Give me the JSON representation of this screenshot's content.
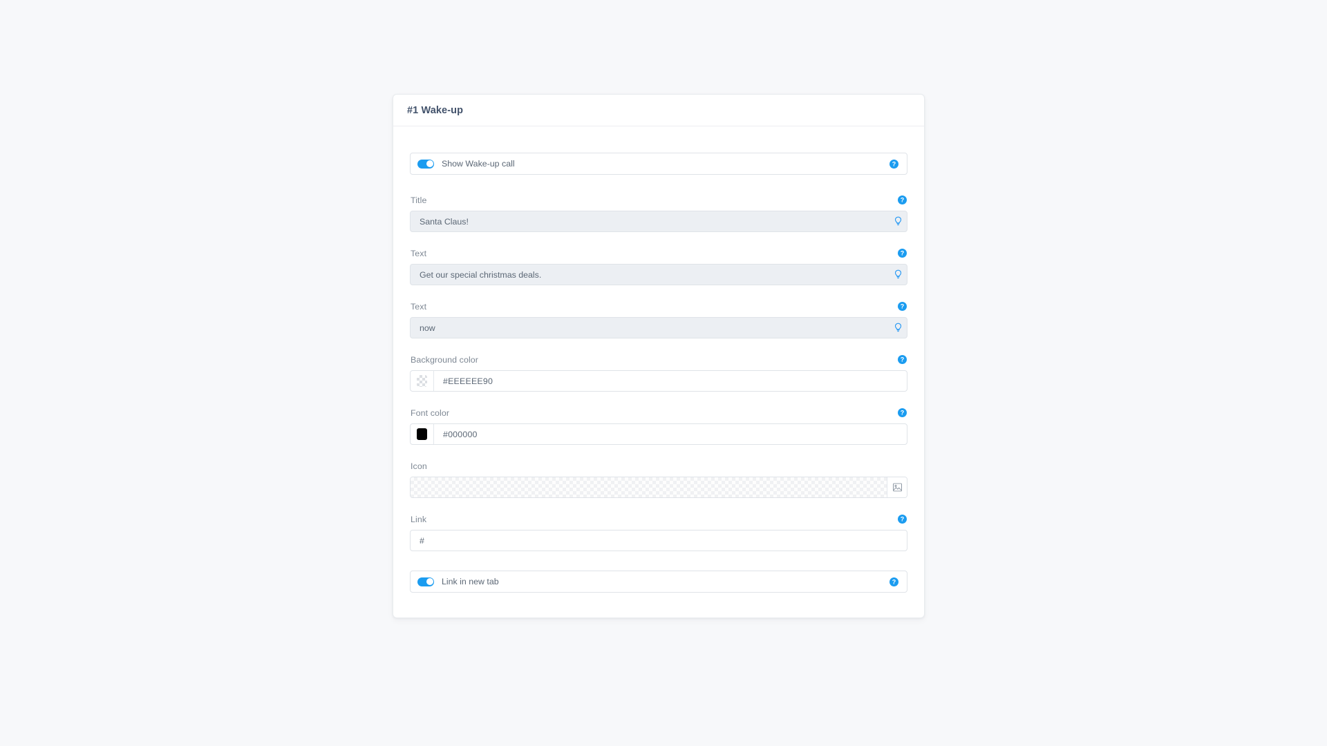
{
  "card": {
    "title": "#1 Wake-up"
  },
  "colors": {
    "accent": "#1b9cf0",
    "label": "#7d8793",
    "value": "#5b6775",
    "border": "#dfe3e8",
    "input_shaded_bg": "#eceff3",
    "page_bg": "#f7f8fa",
    "font_color_swatch": "#000000"
  },
  "icons": {
    "help": "help-circle-icon",
    "bulb": "lightbulb-icon",
    "image": "image-picker-icon"
  },
  "form": {
    "show_wakeup_toggle": {
      "label": "Show Wake-up call",
      "state": "on",
      "has_help": true
    },
    "title_field": {
      "label": "Title",
      "value": "Santa Claus!",
      "placeholder": "Title",
      "has_help": true,
      "has_bulb": true
    },
    "text_field_1": {
      "label": "Text",
      "value": "Get our special christmas deals.",
      "placeholder": "Text",
      "has_help": true,
      "has_bulb": true
    },
    "text_field_2": {
      "label": "Text",
      "value": "now",
      "placeholder": "Text",
      "has_help": true,
      "has_bulb": true
    },
    "background_color_field": {
      "label": "Background color",
      "value": "#EEEEEE90",
      "placeholder": "#EEEEEE90",
      "swatch": "transparent-checkerboard",
      "has_help": true
    },
    "font_color_field": {
      "label": "Font color",
      "value": "#000000",
      "placeholder": "#000000",
      "swatch": "#000000",
      "has_help": true
    },
    "icon_field": {
      "label": "Icon",
      "value": "",
      "preview": "transparent-checkerboard",
      "button_icon": "image-picker-icon",
      "has_help": false
    },
    "link_field": {
      "label": "Link",
      "value": "#",
      "placeholder": "#",
      "has_help": true
    },
    "link_new_tab_toggle": {
      "label": "Link in new tab",
      "state": "on",
      "has_help": true
    }
  }
}
